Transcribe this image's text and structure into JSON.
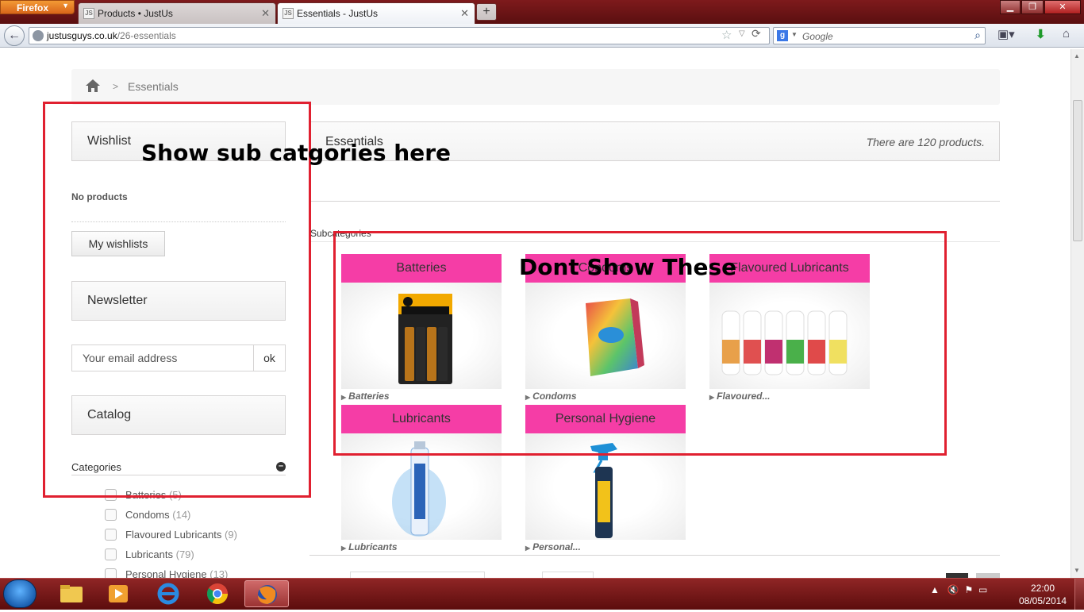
{
  "browser": {
    "menu_label": "Firefox",
    "tabs": [
      {
        "title": "Products • JustUs",
        "favicon": "JS"
      },
      {
        "title": "Essentials - JustUs",
        "favicon": "JS"
      }
    ],
    "new_tab_symbol": "+",
    "url_host": "justusguys.co.uk",
    "url_path": "/26-essentials",
    "search_engine": "Google",
    "search_placeholder": "Google"
  },
  "page": {
    "breadcrumb": {
      "current": "Essentials",
      "separator": ">"
    },
    "wishlist": {
      "title": "Wishlist",
      "empty_text": "No products",
      "button_label": "My wishlists"
    },
    "newsletter": {
      "title": "Newsletter",
      "email_placeholder": "Your email address",
      "submit_label": "ok"
    },
    "catalog": {
      "title": "Catalog",
      "categories_label": "Categories",
      "categories": [
        {
          "name": "Batteries",
          "count": "(5)"
        },
        {
          "name": "Condoms",
          "count": "(14)"
        },
        {
          "name": "Flavoured Lubricants",
          "count": "(9)"
        },
        {
          "name": "Lubricants",
          "count": "(79)"
        },
        {
          "name": "Personal Hygiene",
          "count": "(13)"
        }
      ]
    },
    "content": {
      "title": "Essentials",
      "product_count_text": "There are 120 products.",
      "subcategories_label": "Subcategories",
      "subcategories": [
        {
          "band": "Batteries",
          "caption": "Batteries"
        },
        {
          "band": "Condoms",
          "caption": "Condoms"
        },
        {
          "band": "Flavoured Lubricants",
          "caption": "Flavoured..."
        },
        {
          "band": "Lubricants",
          "caption": "Lubricants"
        },
        {
          "band": "Personal Hygiene",
          "caption": "Personal..."
        }
      ]
    }
  },
  "annotations": {
    "left_note": "Show sub catgories here",
    "right_note": "Dont Show These",
    "color": "#e02030"
  },
  "taskbar": {
    "time": "22:00",
    "date": "08/05/2014"
  },
  "colors": {
    "accent_band": "#f53da6",
    "titlebar": "#7e1a1c"
  }
}
